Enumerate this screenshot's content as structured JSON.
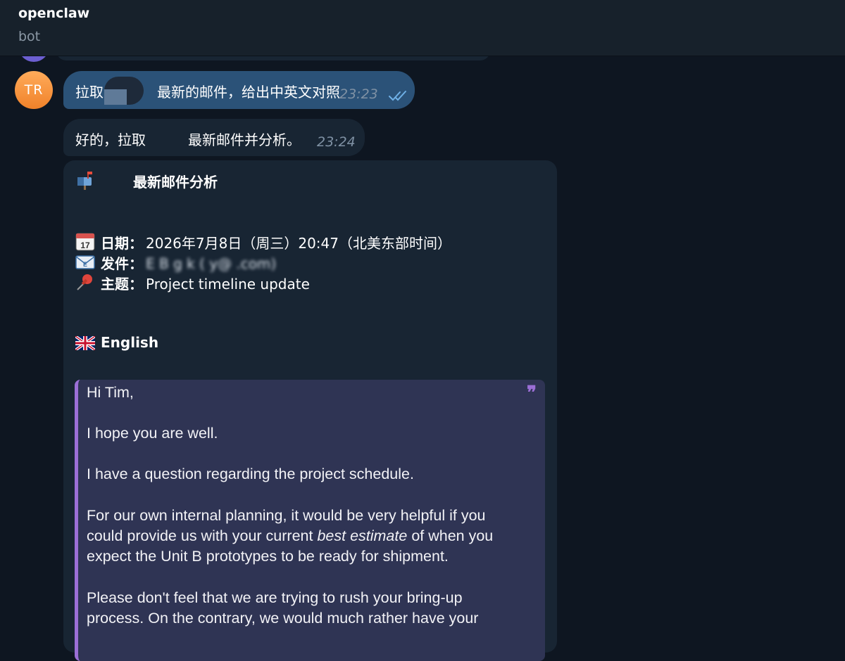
{
  "header": {
    "title": "openclaw",
    "status": "bot"
  },
  "messages": [
    {
      "id": "user-msg",
      "avatar_initials": "TR",
      "text_before": "拉取",
      "text_after": "最新的邮件，给出中英文对照",
      "time": "23:23"
    },
    {
      "id": "bot-reply",
      "text_before": "好的，拉取",
      "text_after": "最新邮件并分析。",
      "time": "23:24"
    }
  ],
  "analysis": {
    "title_icon": "mailbox-icon",
    "title_text": "最新邮件分析",
    "date": {
      "icon": "calendar-icon",
      "calendar_day": "17",
      "label": "日期：",
      "value": "2026年7月8日（周三）20:47（北美东部时间）"
    },
    "sender": {
      "icon": "envelope-icon",
      "label": "发件：",
      "value_blurred": "E    B  g   k  (   y@        .com)"
    },
    "subject": {
      "icon": "pushpin-icon",
      "label": "主题：",
      "value": "Project timeline update"
    },
    "english_header": {
      "icon": "uk-flag-icon",
      "label": "English"
    },
    "quote": {
      "lines": [
        "Hi Tim,",
        "I hope you are well.",
        "I have a question regarding the project schedule.",
        "For our own internal planning, it would be very helpful if you",
        "could provide us with your current",
        "best estimate",
        "of when you",
        "expect the Unit B prototypes to be ready for shipment.",
        "Please don't feel that we are trying to rush your bring-up",
        "process. On the contrary, we would much rather have your"
      ]
    }
  },
  "colors": {
    "background": "#0e1621",
    "header": "#17212b",
    "outgoing_bubble": "#2b5278",
    "incoming_bubble": "#182533",
    "quote_bar": "#9b6fd6",
    "avatar": "#f0822a",
    "read_checks": "#6fb0e6"
  }
}
